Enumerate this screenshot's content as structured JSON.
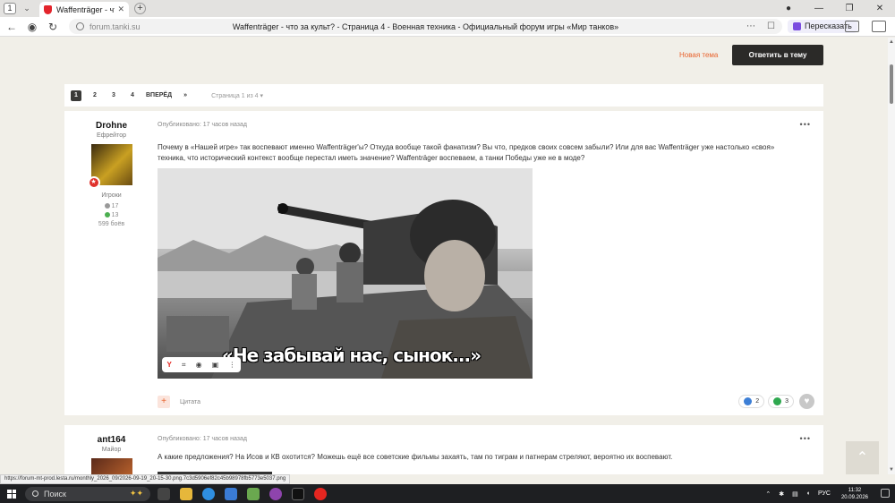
{
  "browser": {
    "tab_count": "1",
    "tab_title": "Waffenträger - что за культ?",
    "url_domain": "forum.tanki.su",
    "page_title": "Waffenträger - что за культ? - Страница 4 - Военная техника - Официальный форум игры «Мир танков»",
    "retell_label": "Пересказать",
    "status_url": "https://forum-mt-prod.lesta.ru/monthly_2026_09/2026-09-19_20-15-30.png.7c3d5906ef82c45b98978fb5773e5037.png"
  },
  "topic_actions": {
    "new_topic": "Новая тема",
    "reply": "Ответить в тему"
  },
  "pagination": {
    "pages": [
      "1",
      "2",
      "3",
      "4"
    ],
    "active": "1",
    "next": "ВПЕРЁД",
    "last": "»",
    "info": "Страница 1 из 4"
  },
  "posts": [
    {
      "author": "Drohne",
      "rank": "Ефрейтор",
      "group": "Игроки",
      "posts_count": "17",
      "reputation": "13",
      "battles": "599 боёв",
      "published": "Опубликовано: 17 часов назад",
      "body": "Почему в «Нашей игре» так воспевают именно Waffenträger'ы? Откуда вообще такой фанатизм? Вы что, предков своих совсем забыли? Или для вас Waffenträger уже настолько «своя» техника, что исторический контекст вообще перестал иметь значение? Waffenträger воспеваем, а танки Победы уже не в моде?",
      "image_caption": "«Не забывай нас, сынок...»",
      "quote_label": "Цитата",
      "likes": "2",
      "upvotes": "3"
    },
    {
      "author": "ant164",
      "rank": "Майор",
      "published": "Опубликовано: 17 часов назад",
      "body": "А какие предложения? На Исов и КВ охотится? Можешь ещё все советские фильмы захаять, там по тиграм и патнерам стреляют, вероятно их воспевают."
    }
  ],
  "taskbar": {
    "search": "Поиск",
    "lang": "РУС",
    "time": "11:32",
    "date": "20.09.2026"
  },
  "colors": {
    "accent": "#e8622c",
    "dark_button": "#2b2a28",
    "page_bg": "#f1efe8"
  }
}
